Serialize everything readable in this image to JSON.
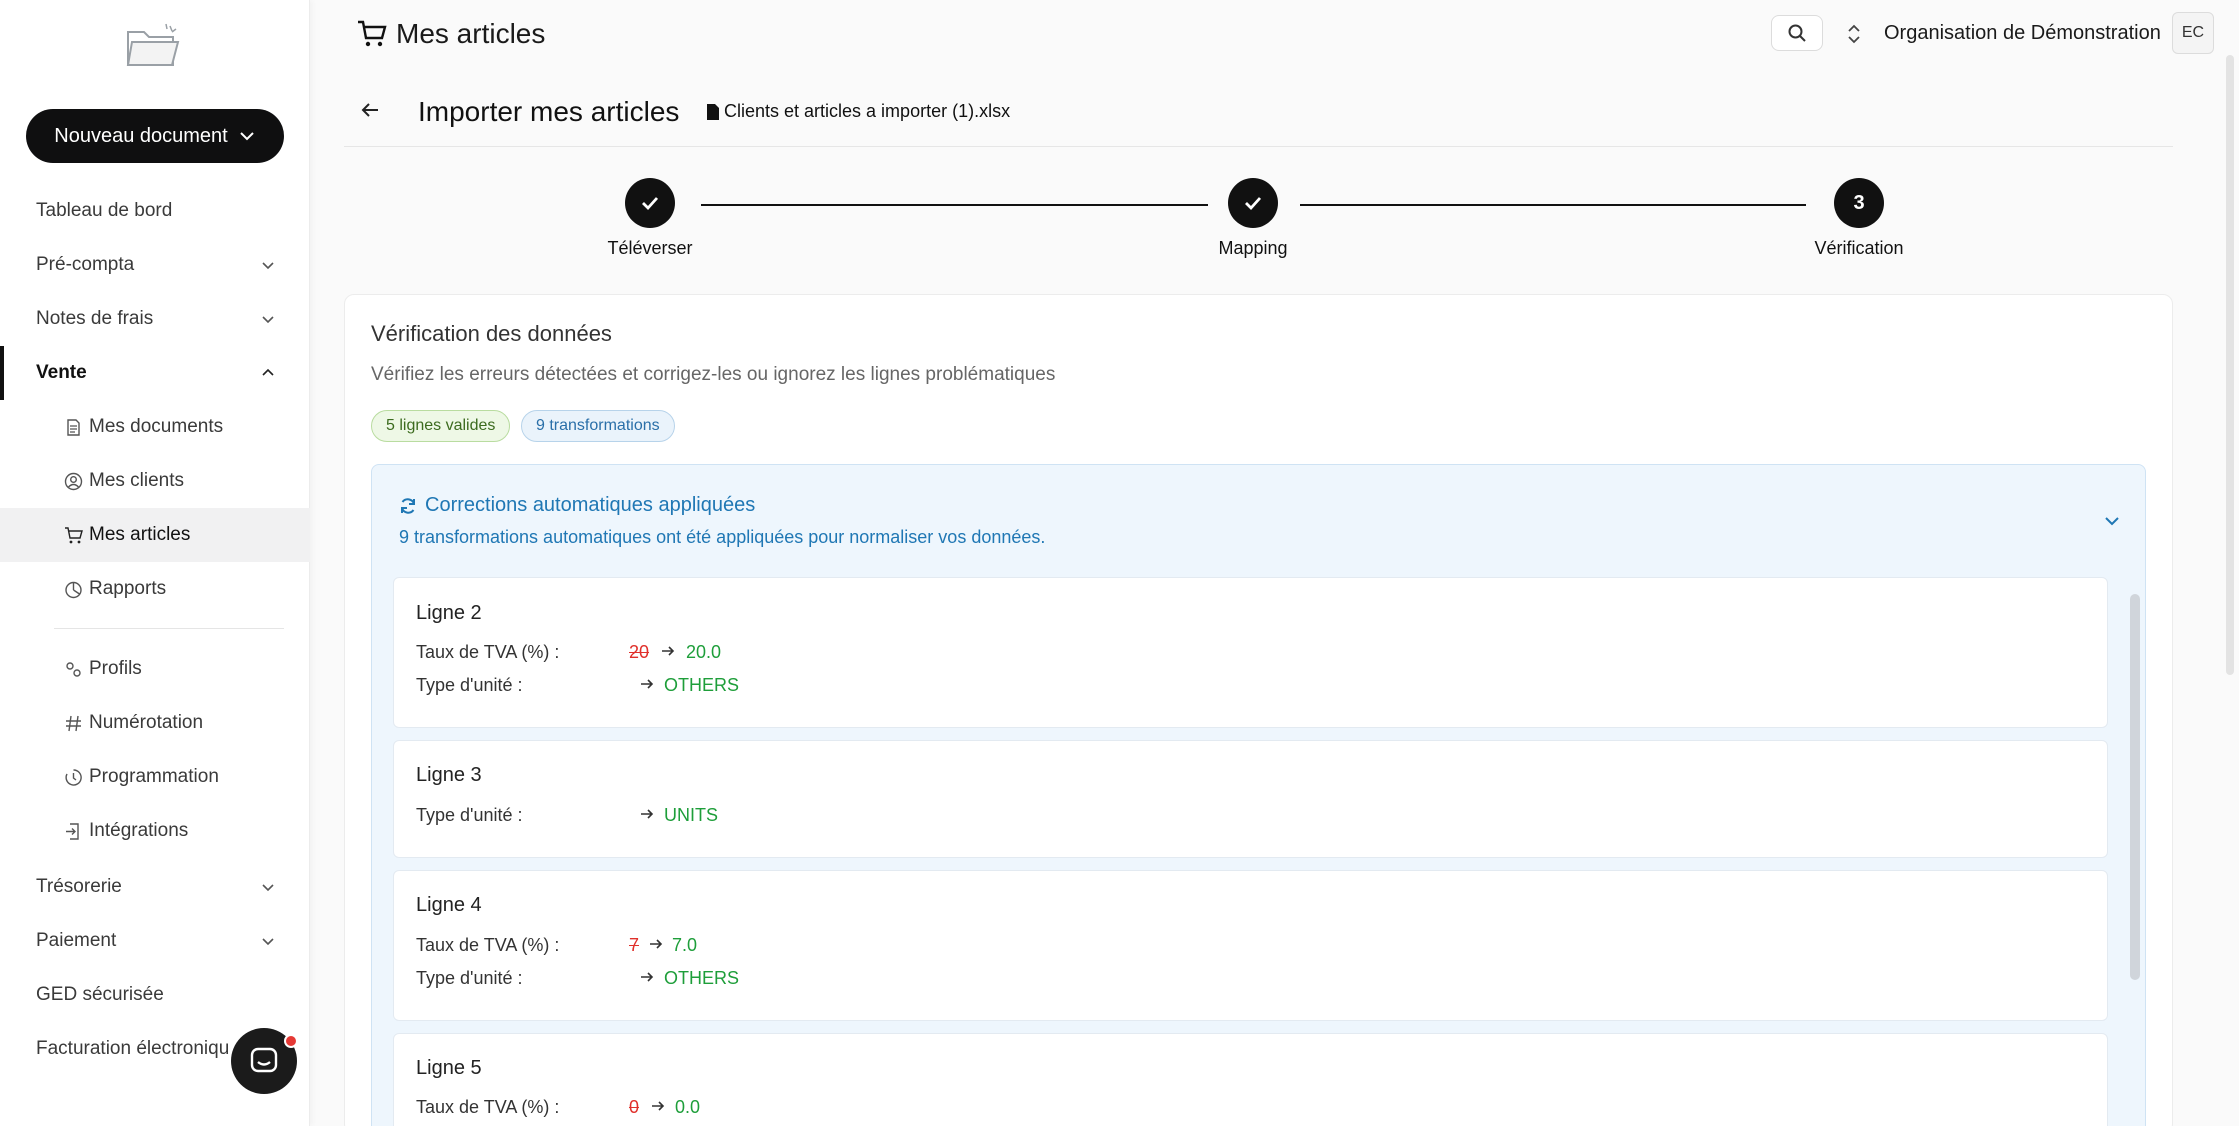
{
  "header": {
    "page_title": "Mes articles",
    "org_name": "Organisation de Démonstration",
    "avatar_initials": "EC"
  },
  "sidebar": {
    "new_document_label": "Nouveau document",
    "items": [
      {
        "label": "Tableau de bord"
      },
      {
        "label": "Pré-compta"
      },
      {
        "label": "Notes de frais"
      },
      {
        "label": "Vente"
      },
      {
        "label": "Trésorerie"
      },
      {
        "label": "Paiement"
      },
      {
        "label": "GED sécurisée"
      },
      {
        "label": "Facturation électroniqu"
      }
    ],
    "sub_items": [
      {
        "label": "Mes documents",
        "icon": "document-icon"
      },
      {
        "label": "Mes clients",
        "icon": "user-circle-icon"
      },
      {
        "label": "Mes articles",
        "icon": "cart-icon"
      },
      {
        "label": "Rapports",
        "icon": "pie-chart-icon"
      },
      {
        "label": "Profils",
        "icon": "gears-icon"
      },
      {
        "label": "Numérotation",
        "icon": "hash-icon"
      },
      {
        "label": "Programmation",
        "icon": "clock-icon"
      },
      {
        "label": "Intégrations",
        "icon": "integration-icon"
      }
    ]
  },
  "import": {
    "title": "Importer mes articles",
    "file_name": "Clients et articles a importer (1).xlsx"
  },
  "stepper": {
    "steps": [
      {
        "label": "Téléverser",
        "state": "done"
      },
      {
        "label": "Mapping",
        "state": "done"
      },
      {
        "label": "Vérification",
        "state": "current",
        "number": "3"
      }
    ]
  },
  "verification": {
    "title": "Vérification des données",
    "subtitle": "Vérifiez les erreurs détectées et corrigez-les ou ignorez les lignes problématiques",
    "badge_valid": "5 lignes valides",
    "badge_transforms": "9 transformations"
  },
  "corrections": {
    "title": "Corrections automatiques appliquées",
    "subtitle": "9 transformations automatiques ont été appliquées pour normaliser vos données.",
    "rows": [
      {
        "title": "Ligne 2",
        "changes": [
          {
            "label": "Taux de TVA (%) :",
            "old": "20",
            "new": "20.0"
          },
          {
            "label": "Type d'unité :",
            "old": "",
            "new": "OTHERS"
          }
        ]
      },
      {
        "title": "Ligne 3",
        "changes": [
          {
            "label": "Type d'unité :",
            "old": "",
            "new": "UNITS"
          }
        ]
      },
      {
        "title": "Ligne 4",
        "changes": [
          {
            "label": "Taux de TVA (%) :",
            "old": "7",
            "new": "7.0"
          },
          {
            "label": "Type d'unité :",
            "old": "",
            "new": "OTHERS"
          }
        ]
      },
      {
        "title": "Ligne 5",
        "changes": [
          {
            "label": "Taux de TVA (%) :",
            "old": "0",
            "new": "0.0"
          }
        ]
      }
    ]
  },
  "colors": {
    "accent": "#111111",
    "info": "#1f77b4",
    "old_value": "#e0302b",
    "new_value": "#1e9e3a"
  }
}
